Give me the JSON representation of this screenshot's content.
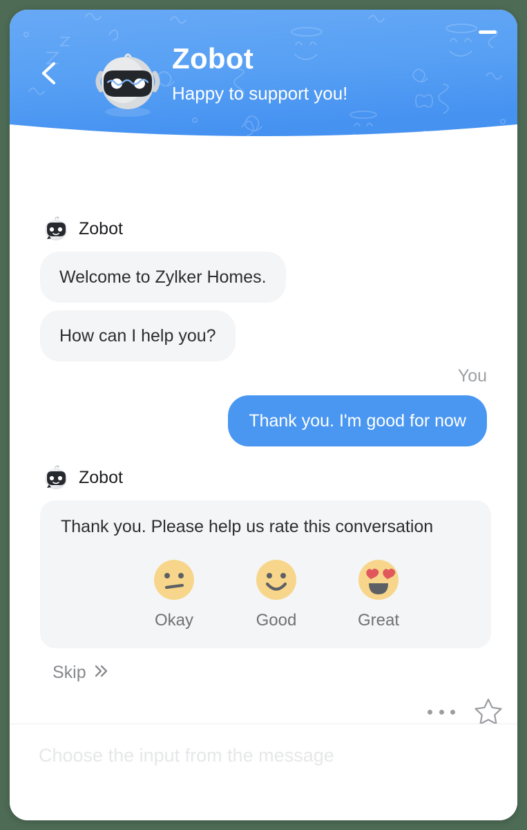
{
  "window": {
    "background_color": "#4d6b55",
    "card_color": "#ffffff"
  },
  "header": {
    "title": "Zobot",
    "subtitle": "Happy to support you!",
    "back_icon": "chevron-left-icon",
    "minimize_icon": "minimize-icon",
    "avatar_icon": "robot-avatar-icon",
    "gradient_from": "#62a6f5",
    "gradient_to": "#4a93f2"
  },
  "conversation": {
    "messages": [
      {
        "sender": "Zobot",
        "type": "bot",
        "texts": [
          "Welcome to Zylker Homes.",
          "How can I help you?"
        ]
      },
      {
        "sender": "You",
        "type": "user",
        "texts": [
          "Thank you. I'm good for now"
        ]
      },
      {
        "sender": "Zobot",
        "type": "bot-rating",
        "texts": [
          "Thank you. Please help us rate this conversation"
        ]
      }
    ],
    "bot_name": "Zobot",
    "user_name": "You",
    "bot_message_1": "Welcome to Zylker Homes.",
    "bot_message_2": "How can I help you?",
    "user_message_1": "Thank you. I'm good for now",
    "bubble_bot_color": "#f4f5f6",
    "bubble_user_color": "#4a97f2"
  },
  "rating": {
    "question": "Thank you. Please help us rate this conversation",
    "options": [
      {
        "label": "Okay",
        "icon": "neutral-face-emoji"
      },
      {
        "label": "Good",
        "icon": "smiling-face-emoji"
      },
      {
        "label": "Great",
        "icon": "heart-eyes-face-emoji"
      }
    ],
    "option_0_label": "Okay",
    "option_1_label": "Good",
    "option_2_label": "Great",
    "skip_label": "Skip",
    "skip_icon": "double-chevron-right-icon",
    "emoji_face_color": "#f7d68c",
    "emoji_heart_color": "#e0585c"
  },
  "actions": {
    "more_icon": "more-options-icon",
    "star_icon": "star-outline-icon"
  },
  "composer": {
    "value": "",
    "placeholder": "Choose the input from the message"
  }
}
